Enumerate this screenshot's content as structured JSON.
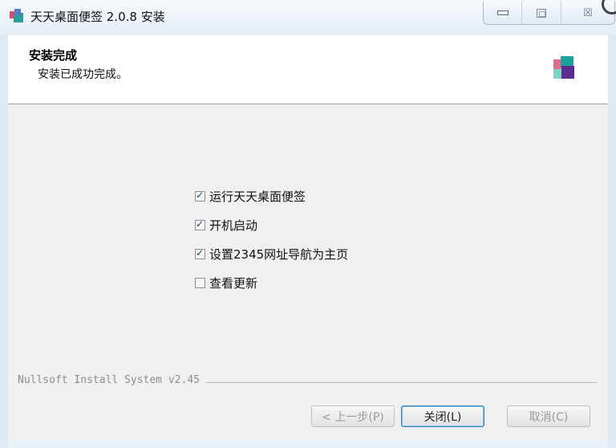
{
  "window": {
    "title": "天天桌面便签 2.0.8 安装",
    "controls": {
      "minimize": "minimize",
      "maximize": "maximize",
      "close": "☒"
    }
  },
  "header": {
    "title": "安装完成",
    "subtitle": "安装已成功完成。"
  },
  "options": [
    {
      "label": "运行天天桌面便签",
      "checked": true
    },
    {
      "label": "开机启动",
      "checked": true
    },
    {
      "label": "设置2345网址导航为主页",
      "checked": true
    },
    {
      "label": "查看更新",
      "checked": false
    }
  ],
  "footer": {
    "brand": "Nullsoft Install System v2.45",
    "back_label": "< 上一步(P)",
    "close_label": "关闭(L)",
    "cancel_label": "取消(C)"
  },
  "colors": {
    "background": "#f0f0f0",
    "header_background": "#ffffff",
    "titlebar": "#e9f1f8"
  }
}
